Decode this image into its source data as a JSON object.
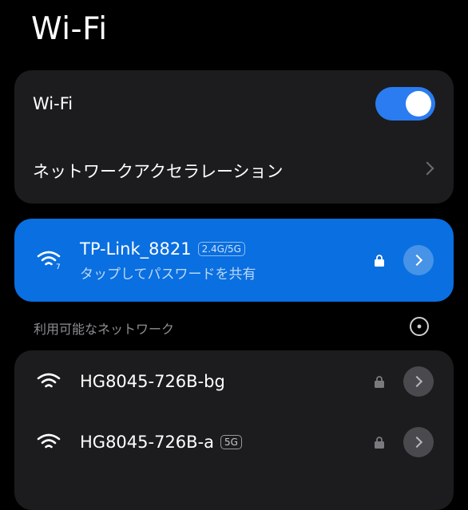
{
  "page": {
    "title": "Wi-Fi"
  },
  "settings": {
    "wifi_label": "Wi-Fi",
    "wifi_enabled": true,
    "acceleration_label": "ネットワークアクセラレーション"
  },
  "connected": {
    "name": "TP-Link_8821",
    "band": "2.4G/5G",
    "subtitle": "タップしてパスワードを共有",
    "secured": true
  },
  "available": {
    "section_title": "利用可能なネットワーク",
    "networks": [
      {
        "name": "HG8045-726B-bg",
        "band": "",
        "secured": true
      },
      {
        "name": "HG8045-726B-a",
        "band": "5G",
        "secured": true
      }
    ]
  },
  "icons": {
    "wifi": "wifi-icon",
    "lock": "lock-icon",
    "chevron": "chevron-right-icon",
    "refresh": "refresh-icon"
  },
  "colors": {
    "background": "#000000",
    "card": "#1c1c1e",
    "connected_card": "#0a6fe0",
    "toggle_on": "#2a7cf0"
  }
}
